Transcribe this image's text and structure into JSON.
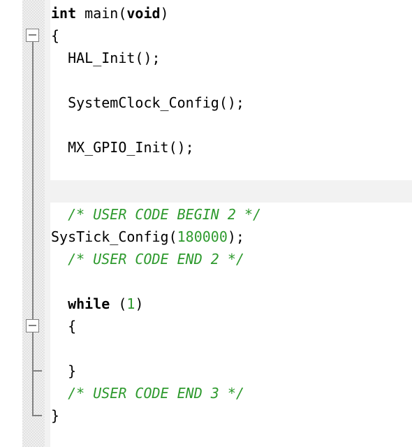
{
  "editor": {
    "language": "C",
    "colors": {
      "keyword": "#000000",
      "number": "#2e9a2e",
      "comment": "#2e9a2e",
      "text": "#000000",
      "caret_line": "#f2f2f2"
    },
    "lines": [
      {
        "tokens": [
          {
            "t": "kw",
            "v": "int"
          },
          {
            "t": "plain",
            "v": " main("
          },
          {
            "t": "kw",
            "v": "void"
          },
          {
            "t": "plain",
            "v": ")"
          }
        ]
      },
      {
        "tokens": [
          {
            "t": "plain",
            "v": "{"
          }
        ]
      },
      {
        "tokens": [
          {
            "t": "plain",
            "v": "  HAL_Init();"
          }
        ]
      },
      {
        "tokens": []
      },
      {
        "tokens": [
          {
            "t": "plain",
            "v": "  SystemClock_Config();"
          }
        ]
      },
      {
        "tokens": []
      },
      {
        "tokens": [
          {
            "t": "plain",
            "v": "  MX_GPIO_Init();"
          }
        ]
      },
      {
        "tokens": []
      },
      {
        "tokens": []
      },
      {
        "tokens": [
          {
            "t": "comment",
            "v": "  /* USER CODE BEGIN 2 */"
          }
        ]
      },
      {
        "tokens": [
          {
            "t": "plain",
            "v": "SysTick_Config("
          },
          {
            "t": "num",
            "v": "180000"
          },
          {
            "t": "plain",
            "v": ");"
          }
        ]
      },
      {
        "tokens": [
          {
            "t": "comment",
            "v": "  /* USER CODE END 2 */"
          }
        ]
      },
      {
        "tokens": []
      },
      {
        "tokens": [
          {
            "t": "plain",
            "v": "  "
          },
          {
            "t": "kw",
            "v": "while"
          },
          {
            "t": "plain",
            "v": " ("
          },
          {
            "t": "num",
            "v": "1"
          },
          {
            "t": "plain",
            "v": ")"
          }
        ]
      },
      {
        "tokens": [
          {
            "t": "plain",
            "v": "  {"
          }
        ]
      },
      {
        "tokens": []
      },
      {
        "tokens": [
          {
            "t": "plain",
            "v": "  }"
          }
        ]
      },
      {
        "tokens": [
          {
            "t": "comment",
            "v": "  /* USER CODE END 3 */"
          }
        ]
      },
      {
        "tokens": [
          {
            "t": "plain",
            "v": "}"
          }
        ]
      }
    ]
  },
  "fold_markers": [
    {
      "line": 2,
      "state": "expanded",
      "icon": "fold-minus-icon"
    },
    {
      "line": 15,
      "state": "expanded",
      "icon": "fold-minus-icon"
    }
  ]
}
